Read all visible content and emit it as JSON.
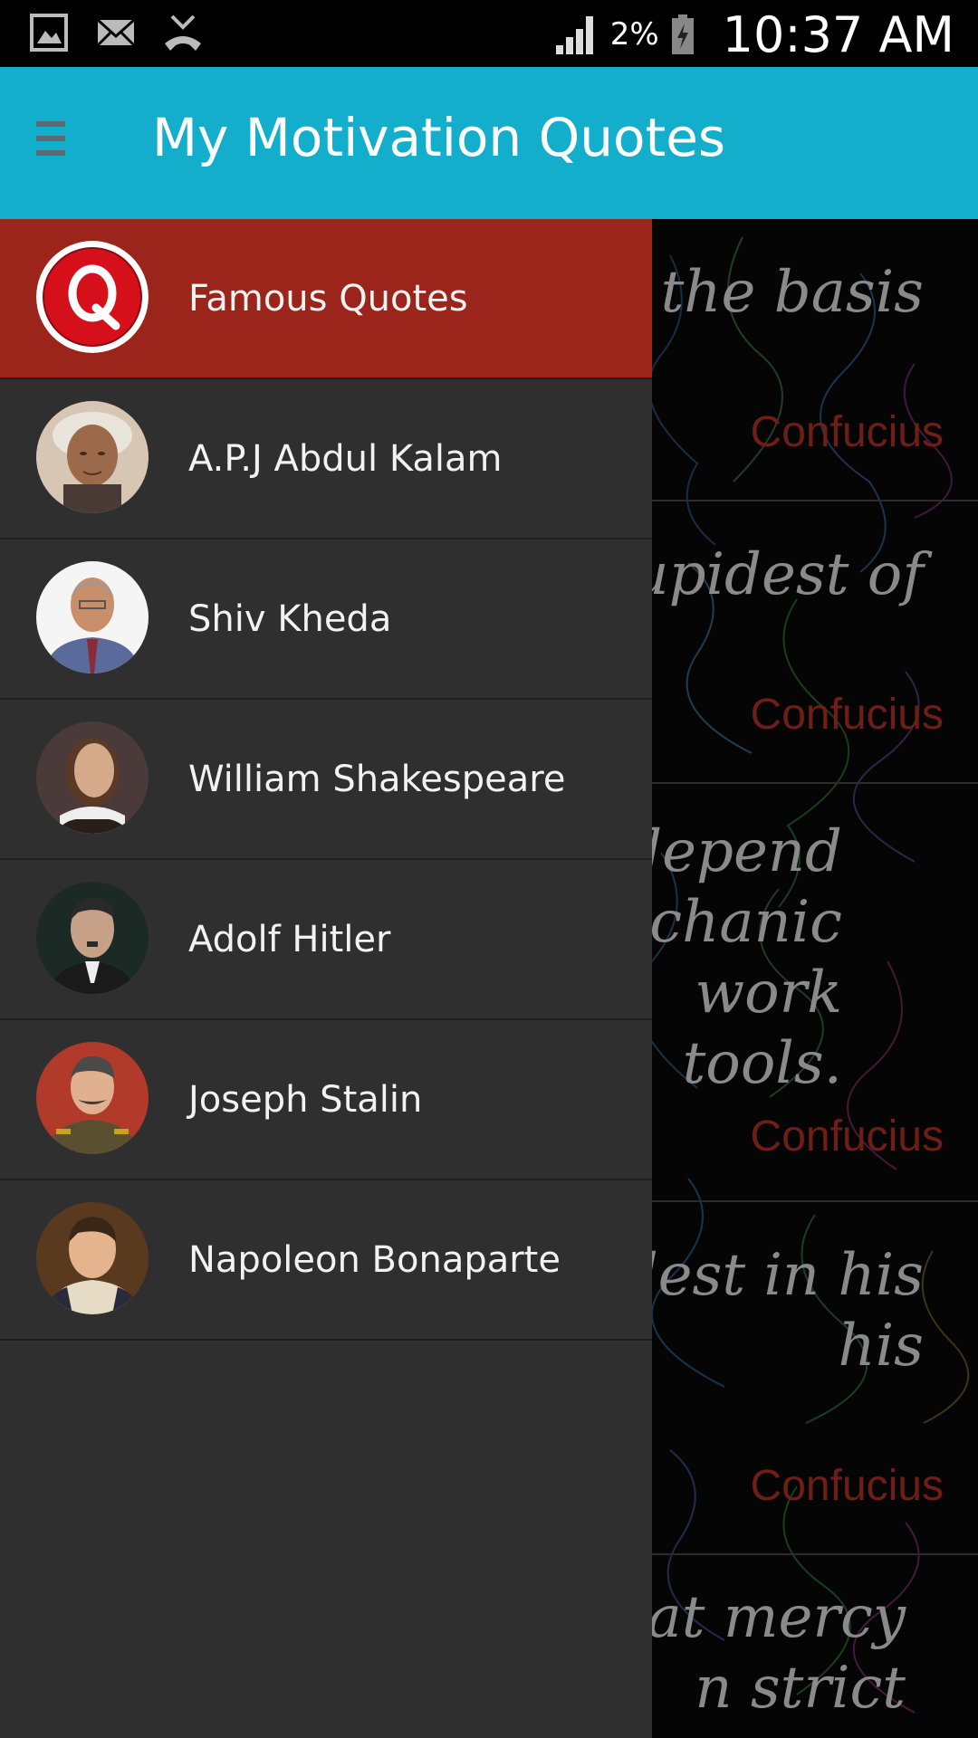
{
  "status_bar": {
    "icons_left": [
      "image-icon",
      "email-icon",
      "missed-call-icon"
    ],
    "signal_icon": "signal-icon",
    "battery_percent": "2%",
    "battery_icon": "battery-icon",
    "time": "10:37 AM"
  },
  "app_bar": {
    "menu_icon": "hamburger-icon",
    "title": "My Motivation Quotes",
    "color": "#12aecb"
  },
  "drawer": {
    "active_color": "#9b241b",
    "items": [
      {
        "label": "Famous Quotes",
        "avatar": "q-logo-icon"
      },
      {
        "label": "A.P.J Abdul Kalam",
        "avatar": "kalam-avatar"
      },
      {
        "label": "Shiv Kheda",
        "avatar": "kheda-avatar"
      },
      {
        "label": "William Shakespeare",
        "avatar": "shakespeare-avatar"
      },
      {
        "label": "Adolf Hitler",
        "avatar": "hitler-avatar"
      },
      {
        "label": "Joseph Stalin",
        "avatar": "stalin-avatar"
      },
      {
        "label": "Napoleon Bonaparte",
        "avatar": "napoleon-avatar"
      }
    ]
  },
  "quotes": [
    {
      "text": "e the basis",
      "author": "Confucius"
    },
    {
      "text": "upidest of",
      "author": "Confucius"
    },
    {
      "text": "e depend\nechanic\n work\n tools.",
      "author": "Confucius"
    },
    {
      "text": "dest in his\n his",
      "author": "Confucius"
    },
    {
      "text": "hat mercy\nn strict",
      "author": ""
    }
  ]
}
